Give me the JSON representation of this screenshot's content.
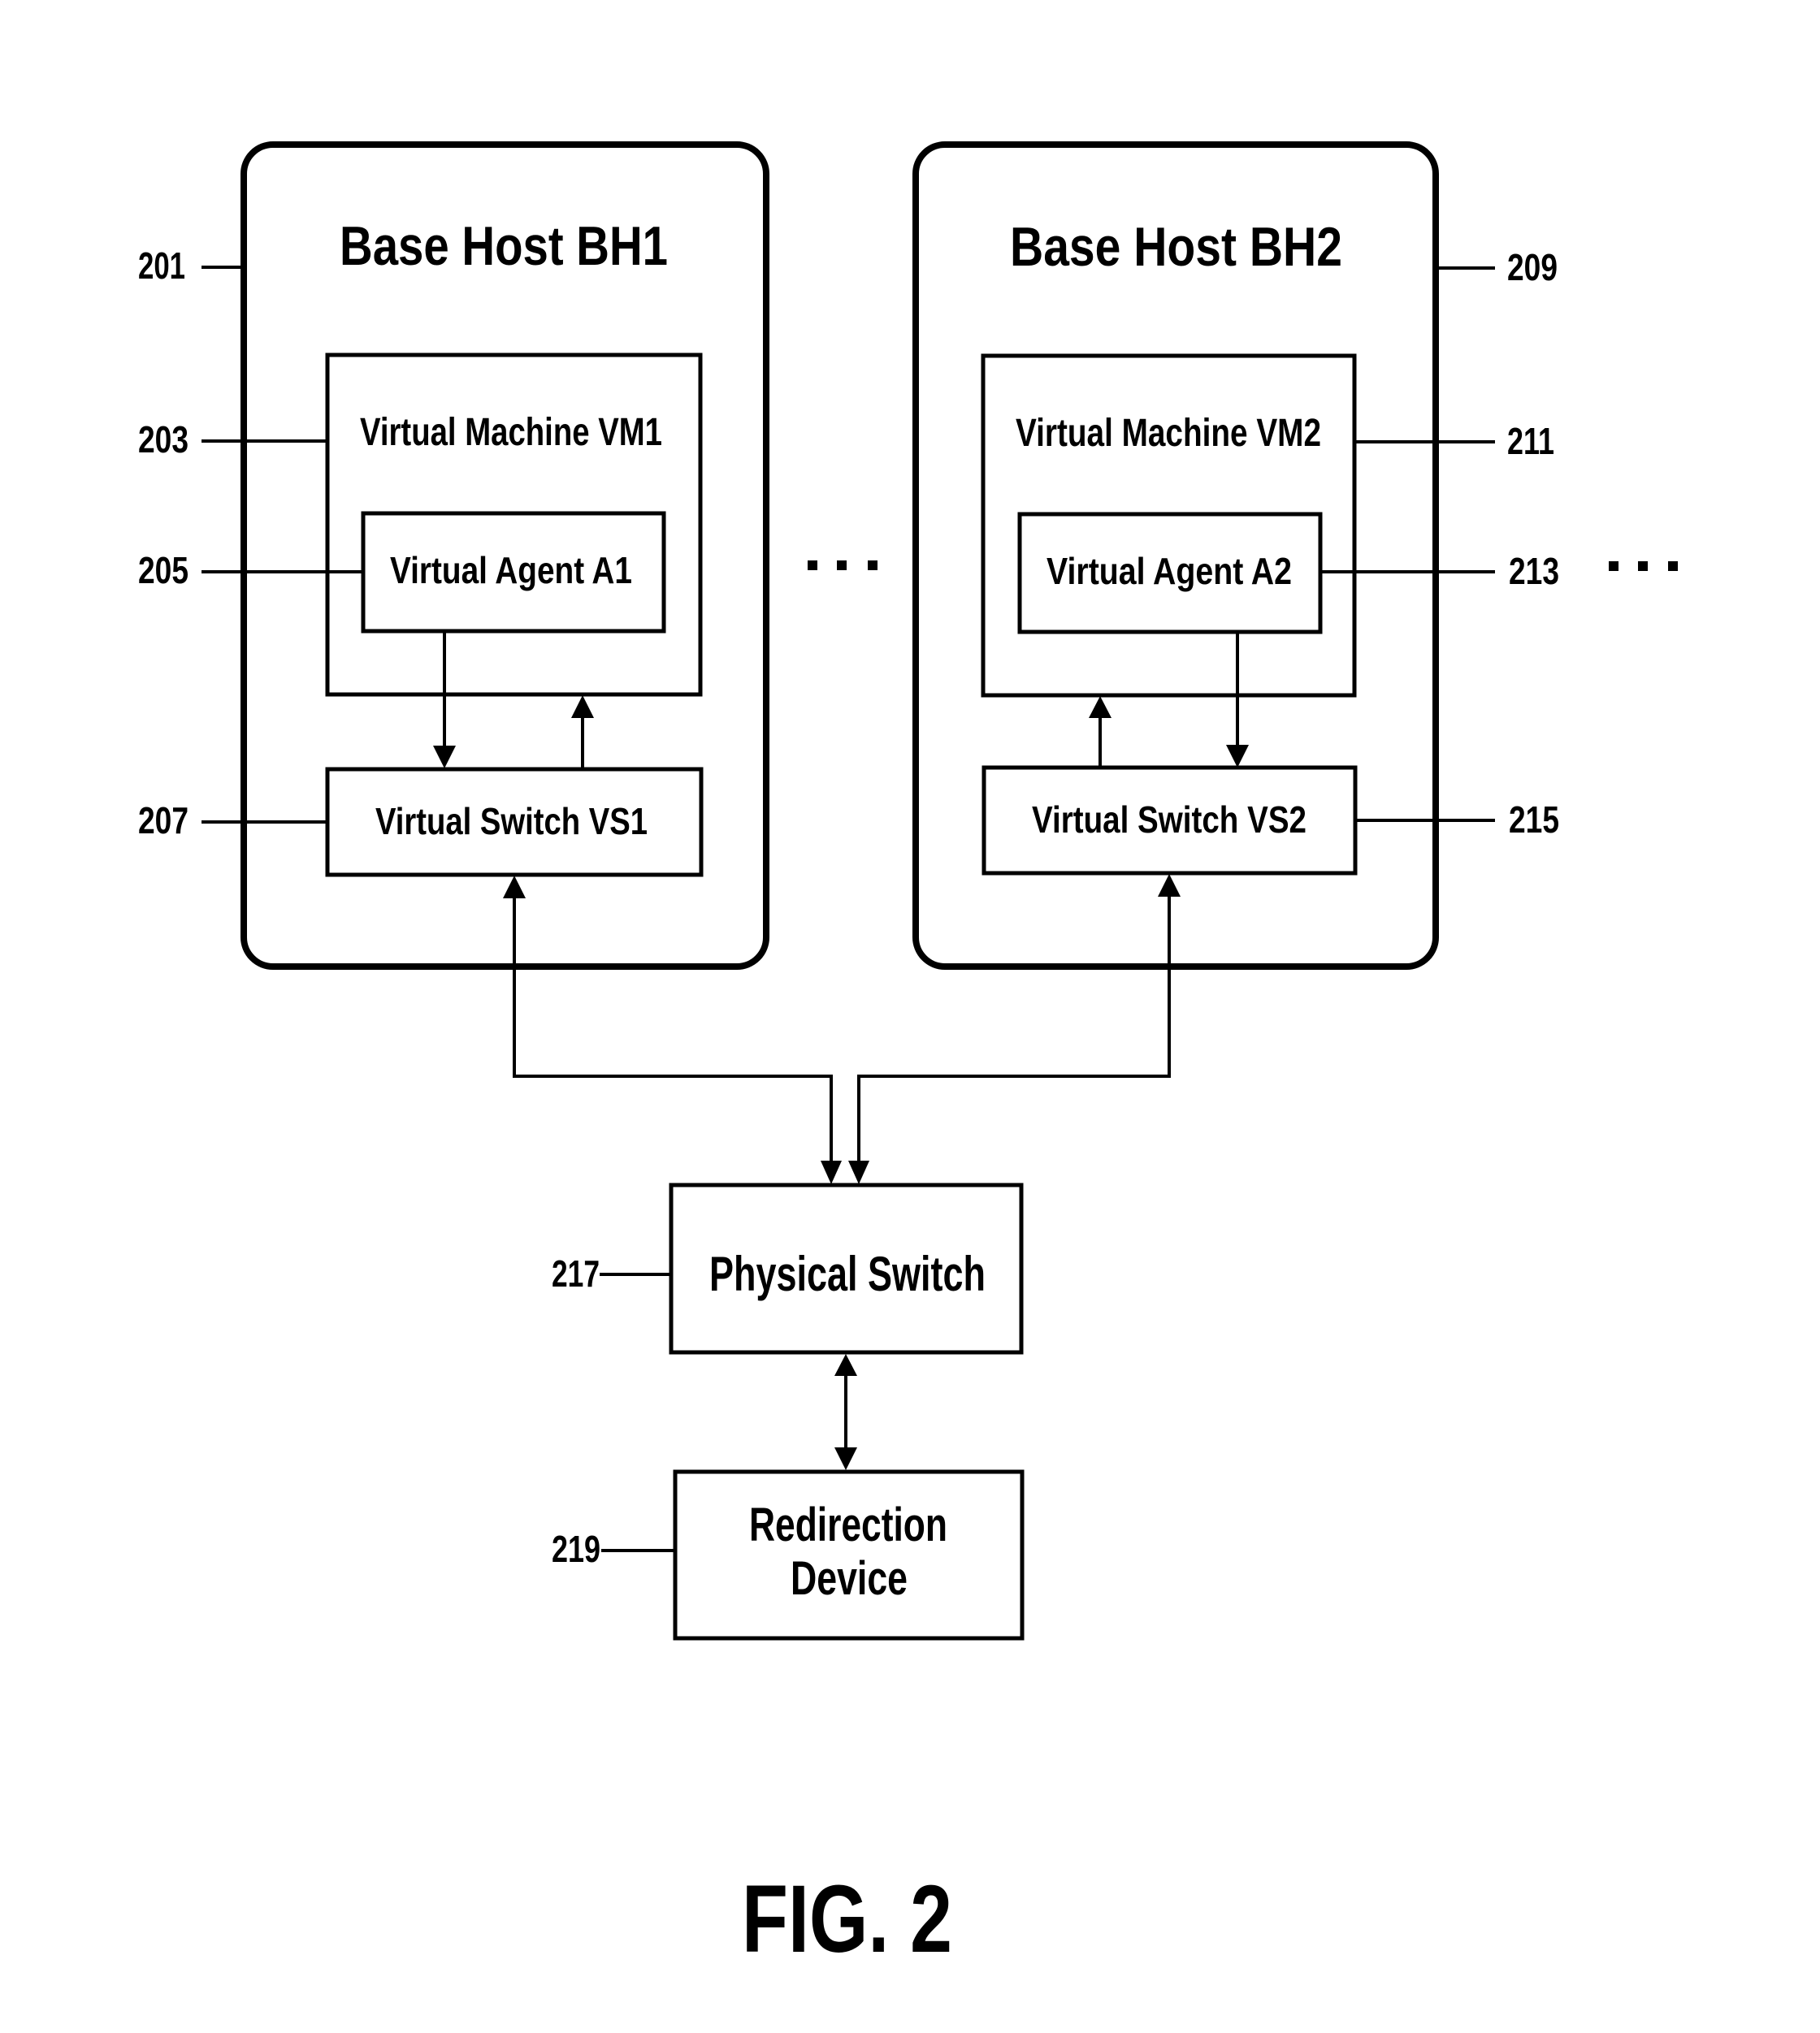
{
  "figure": {
    "caption": "FIG. 2",
    "colors": {
      "ink": "#000000",
      "background": "#ffffff"
    }
  },
  "hosts": [
    {
      "ref": "201",
      "title": "Base Host BH1",
      "vm": {
        "ref": "203",
        "label": "Virtual Machine VM1"
      },
      "agent": {
        "ref": "205",
        "label": "Virtual Agent A1"
      },
      "vswitch": {
        "ref": "207",
        "label": "Virtual Switch VS1"
      }
    },
    {
      "ref": "209",
      "title": "Base Host BH2",
      "vm": {
        "ref": "211",
        "label": "Virtual Machine VM2"
      },
      "agent": {
        "ref": "213",
        "label": "Virtual Agent A2"
      },
      "vswitch": {
        "ref": "215",
        "label": "Virtual Switch VS2"
      }
    }
  ],
  "physical_switch": {
    "ref": "217",
    "label": "Physical Switch"
  },
  "redirection_device": {
    "ref": "219",
    "label_line1": "Redirection",
    "label_line2": "Device"
  },
  "ellipsis": "· · ·"
}
